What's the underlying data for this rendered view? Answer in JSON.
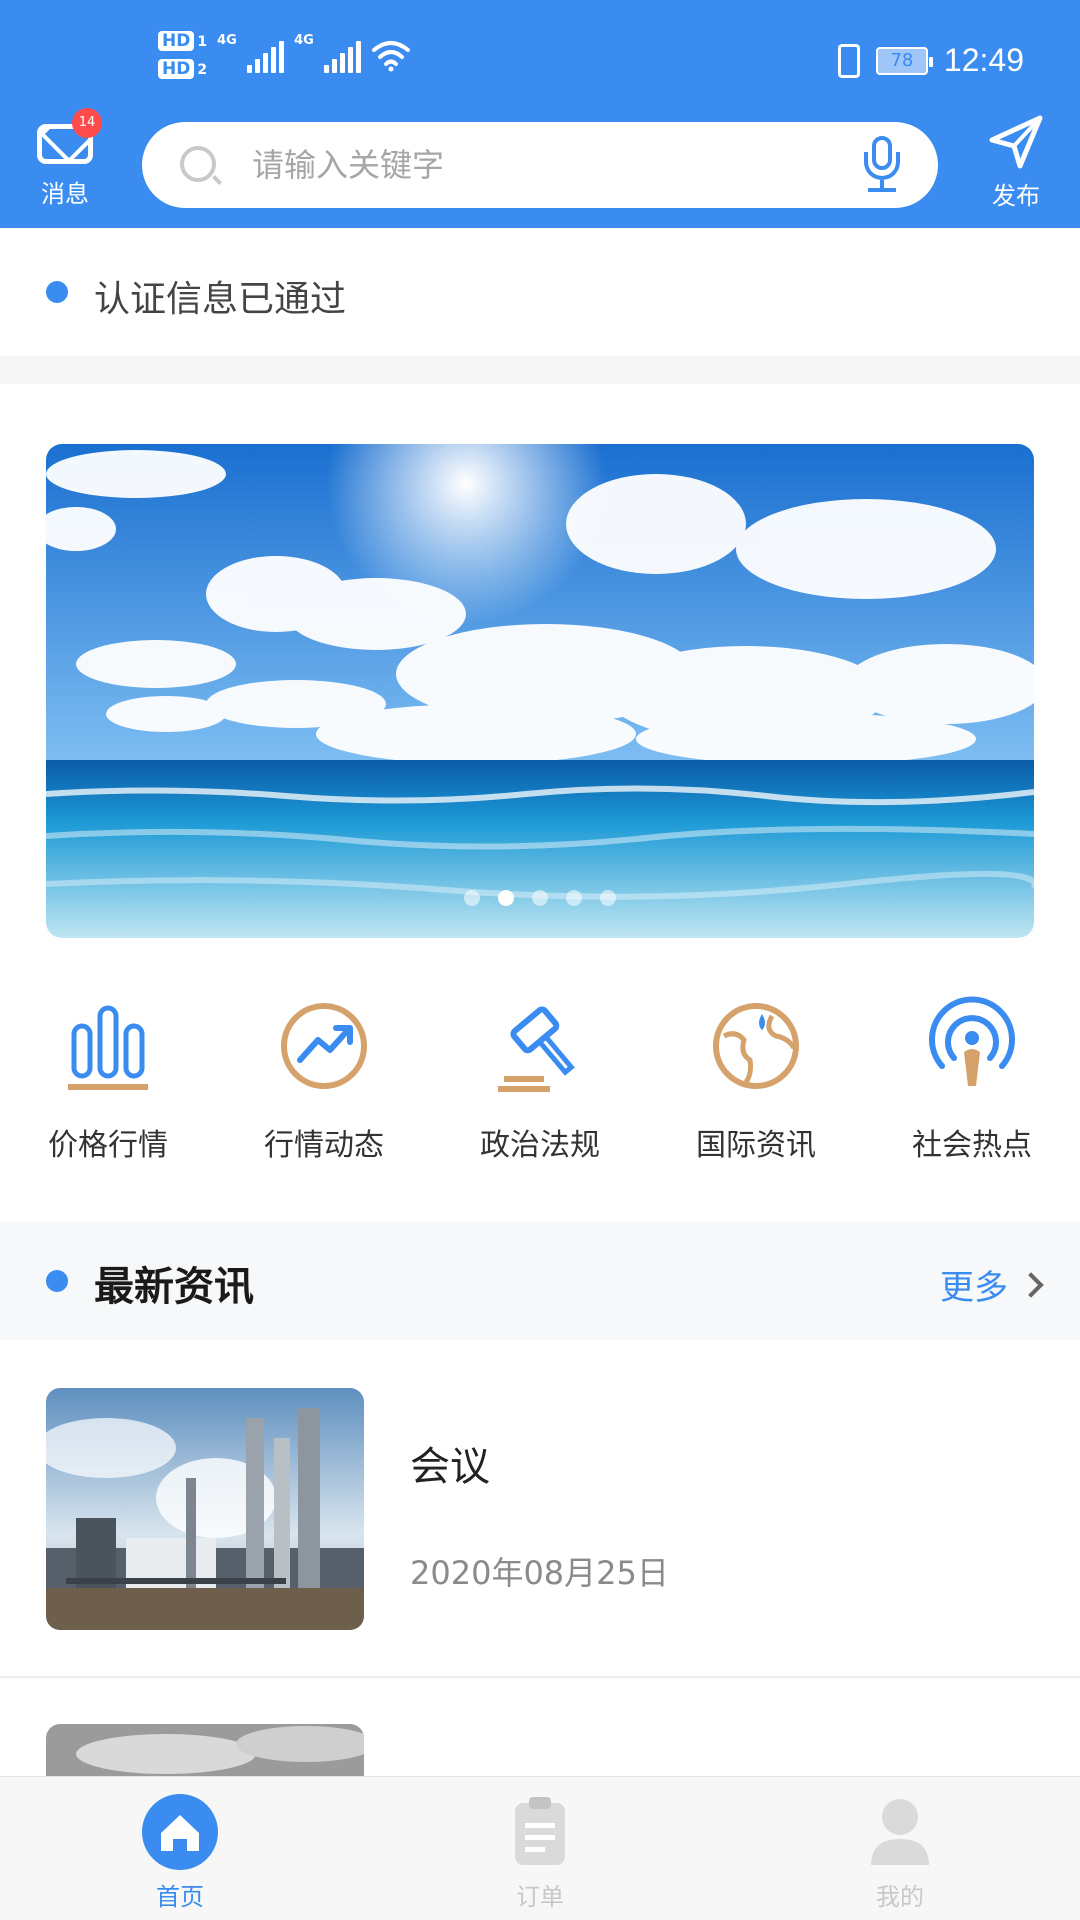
{
  "status_bar": {
    "hd1": "HD",
    "hd1_sub": "1",
    "hd2": "HD",
    "hd2_sub": "2",
    "net1": "4G",
    "net2": "4G",
    "battery": "78",
    "time": "12:49"
  },
  "header": {
    "message_label": "消息",
    "message_badge": "14",
    "search_placeholder": "请输入关键字",
    "publish_label": "发布"
  },
  "verification": {
    "text": "认证信息已通过"
  },
  "banner": {
    "dot_count": 5,
    "active_index": 1
  },
  "categories": [
    {
      "label": "价格行情",
      "icon": "bar-chart-icon"
    },
    {
      "label": "行情动态",
      "icon": "trend-icon"
    },
    {
      "label": "政治法规",
      "icon": "gavel-icon"
    },
    {
      "label": "国际资讯",
      "icon": "globe-icon"
    },
    {
      "label": "社会热点",
      "icon": "broadcast-icon"
    }
  ],
  "news": {
    "title": "最新资讯",
    "more_label": "更多",
    "items": [
      {
        "title": "会议",
        "date": "2020年08月25日"
      },
      {
        "title": "",
        "date": ""
      }
    ]
  },
  "tabbar": {
    "items": [
      {
        "label": "首页",
        "icon": "home-icon",
        "active": true
      },
      {
        "label": "订单",
        "icon": "clipboard-icon",
        "active": false
      },
      {
        "label": "我的",
        "icon": "user-icon",
        "active": false
      }
    ]
  },
  "colors": {
    "primary": "#3a8cf0",
    "accent_gold": "#d4a26a",
    "badge_red": "#ff4b4b"
  }
}
